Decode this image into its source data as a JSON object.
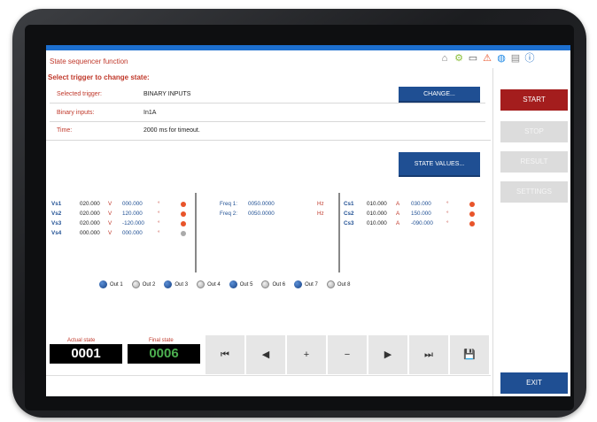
{
  "header": {
    "title": "State sequencer function",
    "icons": [
      "home-icon",
      "gear-icon",
      "monitor-icon",
      "warning-icon",
      "globe-icon",
      "document-icon",
      "info-icon"
    ]
  },
  "trigger": {
    "heading": "Select trigger to change state:",
    "selected_label": "Selected trigger:",
    "selected_value": "BINARY INPUTS",
    "binary_label": "Binary inputs:",
    "binary_value": "In1A",
    "time_label": "Time:",
    "time_value": "2000 ms for timeout.",
    "change_button": "CHANGE..."
  },
  "state_values_button": "STATE VALUES...",
  "voltages": [
    {
      "name": "Vs1",
      "mag": "020.000",
      "unit": "V",
      "ang": "000.000",
      "deg": "°",
      "color": "#e8542a"
    },
    {
      "name": "Vs2",
      "mag": "020.000",
      "unit": "V",
      "ang": "120.000",
      "deg": "°",
      "color": "#e8542a"
    },
    {
      "name": "Vs3",
      "mag": "020.000",
      "unit": "V",
      "ang": "-120.000",
      "deg": "°",
      "color": "#e8542a"
    },
    {
      "name": "Vs4",
      "mag": "000.000",
      "unit": "V",
      "ang": "000.000",
      "deg": "°",
      "color": "#aaaaaa"
    }
  ],
  "freqs": [
    {
      "name": "Freq 1:",
      "val": "0050.0000",
      "unit": "Hz"
    },
    {
      "name": "Freq 2:",
      "val": "0050.0000",
      "unit": "Hz"
    }
  ],
  "currents": [
    {
      "name": "Cs1",
      "mag": "010.000",
      "unit": "A",
      "ang": "030.000",
      "deg": "°",
      "color": "#e8542a"
    },
    {
      "name": "Cs2",
      "mag": "010.000",
      "unit": "A",
      "ang": "150.000",
      "deg": "°",
      "color": "#e8542a"
    },
    {
      "name": "Cs3",
      "mag": "010.000",
      "unit": "A",
      "ang": "-090.000",
      "deg": "°",
      "color": "#e8542a"
    }
  ],
  "outputs": [
    {
      "label": "Out 1",
      "on": true
    },
    {
      "label": "Out 2",
      "on": false
    },
    {
      "label": "Out 3",
      "on": true
    },
    {
      "label": "Out 4",
      "on": false
    },
    {
      "label": "Out 5",
      "on": true
    },
    {
      "label": "Out 6",
      "on": false
    },
    {
      "label": "Out 7",
      "on": true
    },
    {
      "label": "Out 8",
      "on": false
    }
  ],
  "states": {
    "actual_label": "Actual state",
    "actual_value": "0001",
    "final_label": "Final state",
    "final_value": "0006"
  },
  "nav": [
    "⏮",
    "◀",
    "+",
    "−",
    "▶",
    "⏭",
    "💾"
  ],
  "side": {
    "start": "START",
    "stop": "STOP",
    "result": "RESULT",
    "settings": "SETTINGS",
    "exit": "EXIT"
  }
}
